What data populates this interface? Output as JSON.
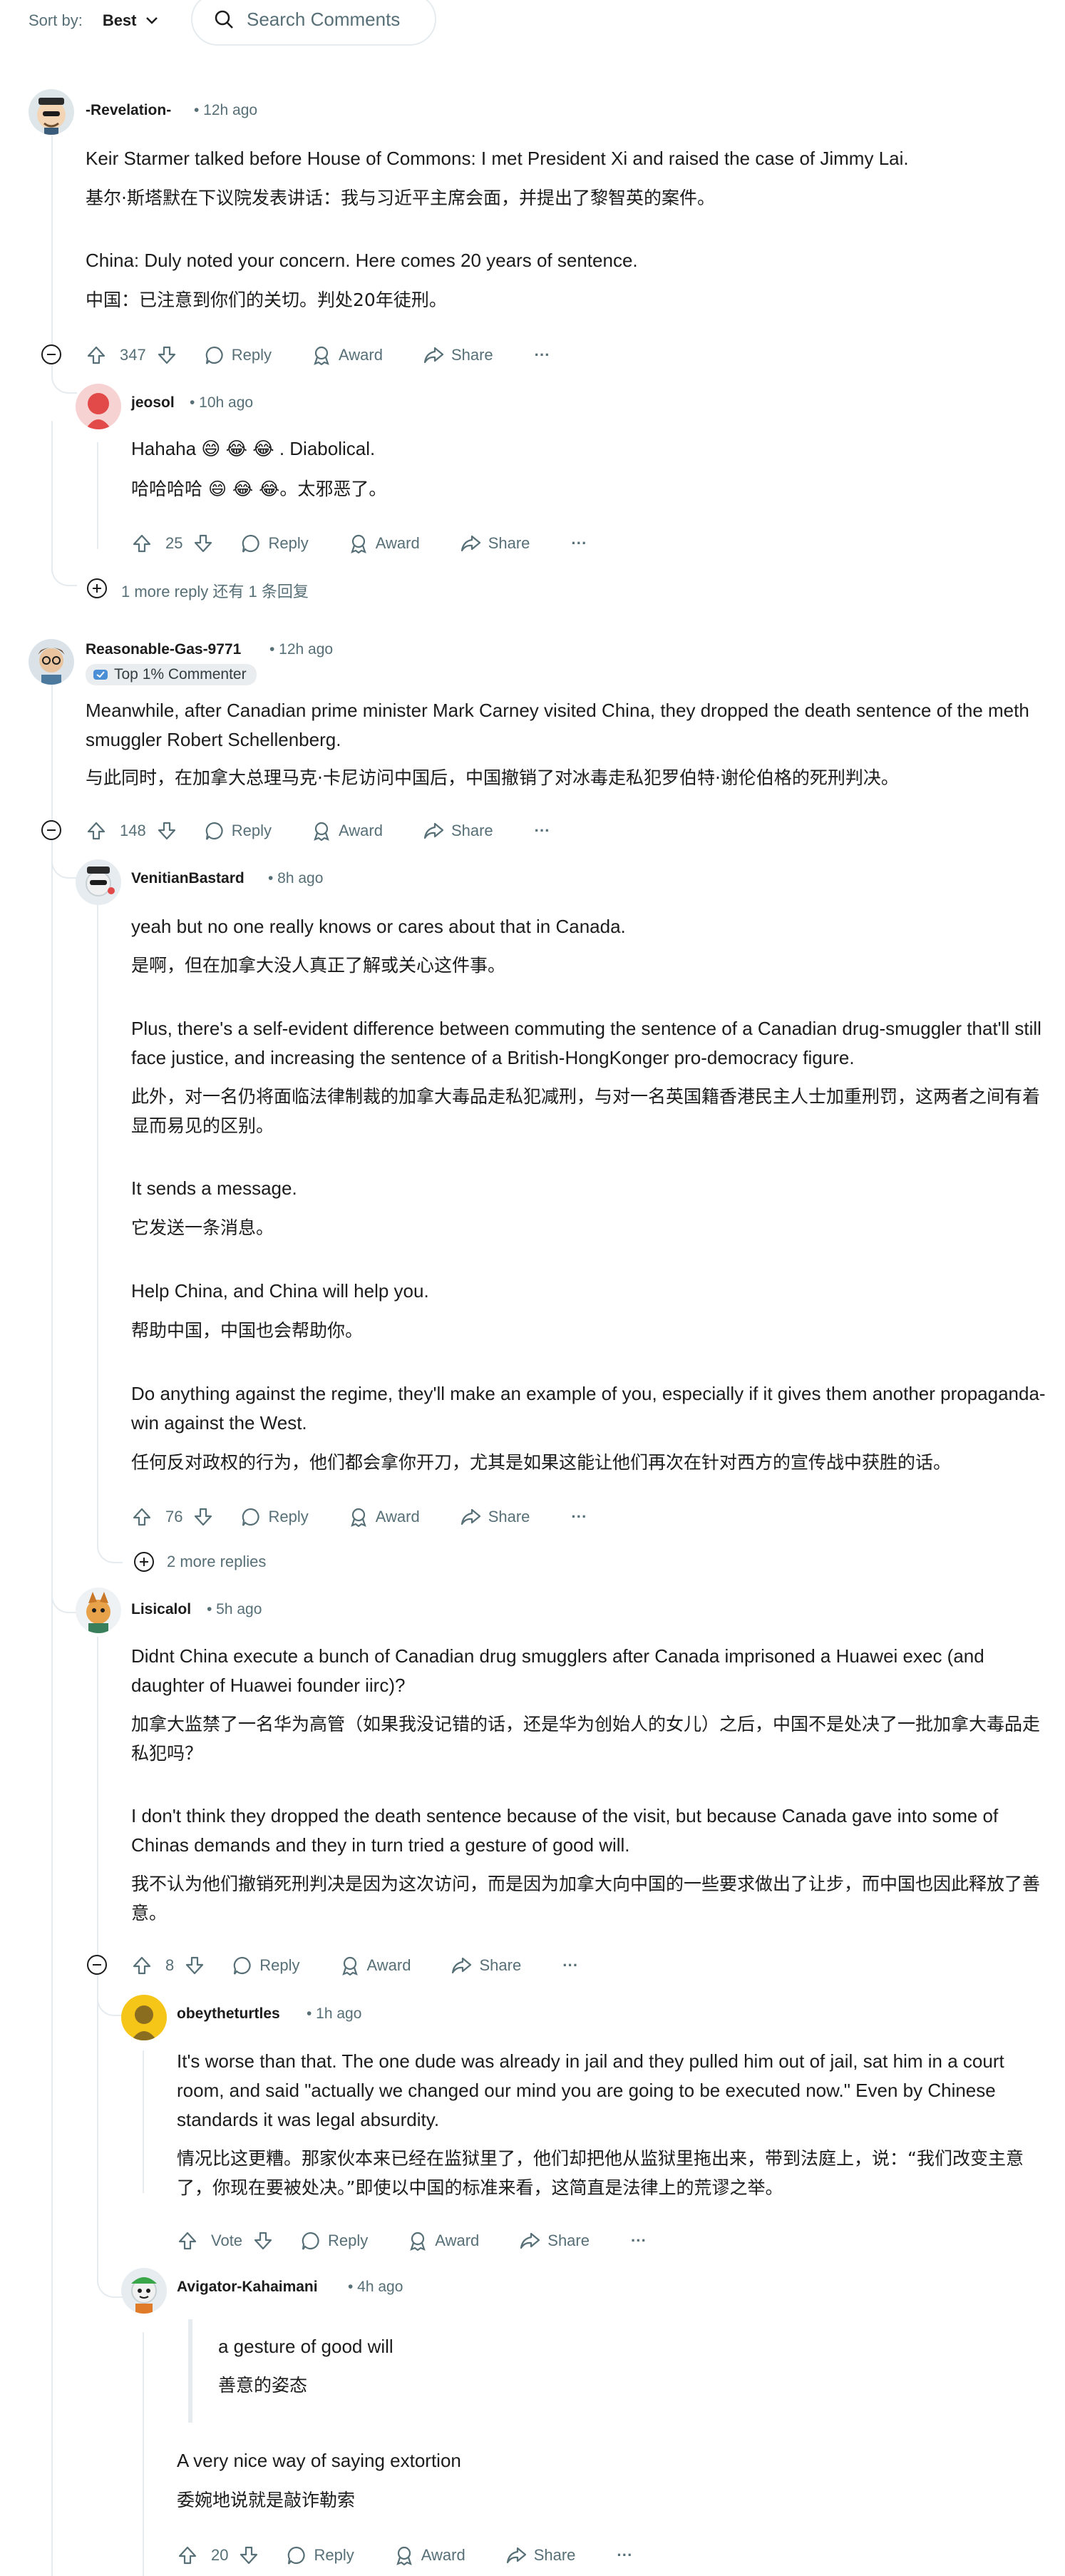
{
  "sortbar": {
    "label": "Sort by:",
    "value": "Best",
    "search_placeholder": "Search Comments"
  },
  "actions": {
    "reply": "Reply",
    "award": "Award",
    "share": "Share",
    "more": "···"
  },
  "comments": {
    "c1": {
      "author": "-Revelation-",
      "time": "• 12h ago",
      "votes": "347",
      "paragraphs": [
        "Keir Starmer talked before House of Commons: I met President Xi and raised the case of Jimmy Lai.",
        "基尔·斯塔默在下议院发表讲话：我与习近平主席会面，并提出了黎智英的案件。",
        "China: Duly noted your concern. Here comes 20 years of sentence.",
        "中国：已注意到你们的关切。判处20年徒刑。"
      ],
      "more_replies": "1 more reply  还有 1 条回复"
    },
    "c1r1": {
      "author": "jeosol",
      "time": "• 10h ago",
      "votes": "25",
      "paragraphs": [
        "Hahaha 😄 😂 😂 . Diabolical.",
        "哈哈哈哈 😄 😂 😂。太邪恶了。"
      ]
    },
    "c2": {
      "author": "Reasonable-Gas-9771",
      "time": "• 12h ago",
      "badge": "Top 1% Commenter",
      "votes": "148",
      "paragraphs": [
        "Meanwhile, after Canadian prime minister Mark Carney visited China, they dropped the death sentence of the meth smuggler Robert Schellenberg.",
        "与此同时，在加拿大总理马克·卡尼访问中国后，中国撤销了对冰毒走私犯罗伯特·谢伦伯格的死刑判决。"
      ]
    },
    "c2r1": {
      "author": "VenitianBastard",
      "time": "• 8h ago",
      "votes": "76",
      "paragraphs": [
        "yeah but no one really knows or cares about that in Canada.",
        "是啊，但在加拿大没人真正了解或关心这件事。",
        "Plus, there's a self-evident difference between commuting the sentence of a Canadian drug-smuggler that'll still face justice, and increasing the sentence of a British-HongKonger pro-democracy figure.",
        "此外，对一名仍将面临法律制裁的加拿大毒品走私犯减刑，与对一名英国籍香港民主人士加重刑罚，这两者之间有着显而易见的区别。",
        "It sends a message.",
        "它发送一条消息。",
        "Help China, and China will help you.",
        "帮助中国，中国也会帮助你。",
        "Do anything against the regime, they'll make an example of you, especially if it gives them another propaganda-win against the West.",
        "任何反对政权的行为，他们都会拿你开刀，尤其是如果这能让他们再次在针对西方的宣传战中获胜的话。"
      ],
      "more_replies": "2 more replies"
    },
    "c2r2": {
      "author": "Lisicalol",
      "time": "• 5h ago",
      "votes": "8",
      "paragraphs": [
        "Didnt China execute a bunch of Canadian drug smugglers after Canada imprisoned a Huawei exec (and daughter of Huawei founder iirc)?",
        "加拿大监禁了一名华为高管（如果我没记错的话，还是华为创始人的女儿）之后，中国不是处决了一批加拿大毒品走私犯吗？",
        "I don't think they dropped the death sentence because of the visit, but because Canada gave into some of Chinas demands and they in turn tried a gesture of good will.",
        "我不认为他们撤销死刑判决是因为这次访问，而是因为加拿大向中国的一些要求做出了让步，而中国也因此释放了善意。"
      ]
    },
    "c2r2r1": {
      "author": "obeytheturtles",
      "time": "• 1h ago",
      "votes": "Vote",
      "paragraphs": [
        "It's worse than that. The one dude was already in jail and they pulled him out of jail, sat him in a court room, and said \"actually we changed our mind you are going to be executed now.\" Even by Chinese standards it was legal absurdity.",
        "情况比这更糟。那家伙本来已经在监狱里了，他们却把他从监狱里拖出来，带到法庭上，说：“我们改变主意了，你现在要被处决。”即使以中国的标准来看，这简直是法律上的荒谬之举。"
      ]
    },
    "c2r2r2": {
      "author": "Avigator-Kahaimani",
      "time": "• 4h ago",
      "votes": "20",
      "quote": [
        "a gesture of good will",
        "善意的姿态"
      ],
      "paragraphs": [
        "A very nice way of saying extortion",
        "委婉地说就是敲诈勒索"
      ]
    }
  }
}
